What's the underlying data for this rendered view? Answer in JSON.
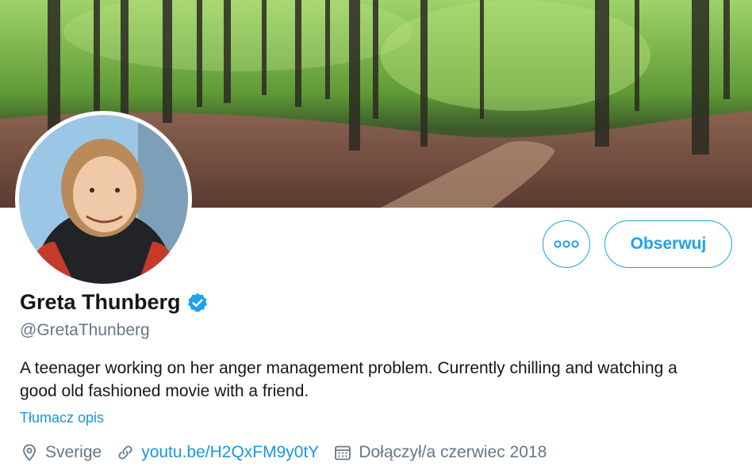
{
  "profile": {
    "name": "Greta Thunberg",
    "handle": "@GretaThunberg",
    "bio": "A teenager working on her anger management problem. Currently chilling and watching a good old fashioned movie with a friend.",
    "translate_label": "Tłumacz opis",
    "location": "Sverige",
    "website": "youtu.be/H2QxFM9y0tY",
    "joined": "Dołączył/a czerwiec 2018",
    "verified": true
  },
  "actions": {
    "follow_label": "Obserwuj",
    "more_icon": "more-icon"
  },
  "icons": {
    "location": "location-pin-icon",
    "link": "link-icon",
    "calendar": "calendar-icon",
    "verified": "verified-badge-icon"
  },
  "colors": {
    "accent": "#1da1f2",
    "link": "#1b95e0",
    "muted": "#657786",
    "text": "#14171a"
  }
}
